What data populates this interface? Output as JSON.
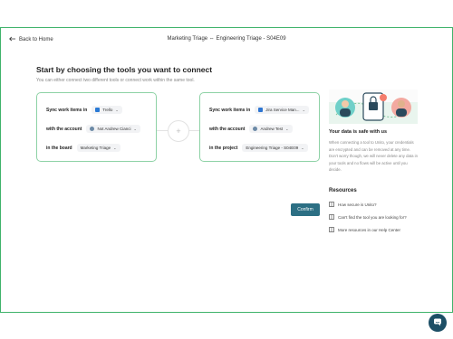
{
  "topbar": {
    "back_label": "Back to Home",
    "title": "Marketing Triage ⇔ Engineering Triage - S04E09"
  },
  "main": {
    "heading": "Start by choosing the tools you want to connect",
    "subheading": "You can either connect two different tools or connect work within the same tool."
  },
  "left_card": {
    "sync_label": "Sync work items in",
    "tool": "Trello",
    "account_label": "with the account",
    "account": "Not Andrew Cianci",
    "board_label": "in the board",
    "board": "Marketing Triage"
  },
  "right_card": {
    "sync_label": "Sync work items in",
    "tool": "Jira Service Man...",
    "account_label": "with the account",
    "account": "Andrew Test",
    "project_label": "in the project",
    "project": "Engineering Triage - S04E09"
  },
  "connector": {
    "plus_symbol": "+"
  },
  "confirm_label": "Confirm",
  "sidebar": {
    "safe_title": "Your data is safe with us",
    "safe_text": "When connecting a tool to Unito, your credentials are encrypted and can be removed at any time. Don't worry though, we will never delete any data in your tools and no flows will be active until you decide.",
    "resources_title": "Resources",
    "resources": [
      {
        "label": "How secure is Unito?"
      },
      {
        "label": "Can't find the tool you are looking for?"
      },
      {
        "label": "More resources in our Help Center"
      }
    ]
  },
  "colors": {
    "frame_border": "#3fb36b",
    "card_border": "#8dd2a5",
    "confirm_bg": "#2c6f84",
    "chat_bg": "#1d4f66"
  },
  "icons": {
    "back": "arrow-left-icon",
    "trello": "trello-icon",
    "jira": "jira-icon",
    "chat": "chat-bubble-icon"
  }
}
